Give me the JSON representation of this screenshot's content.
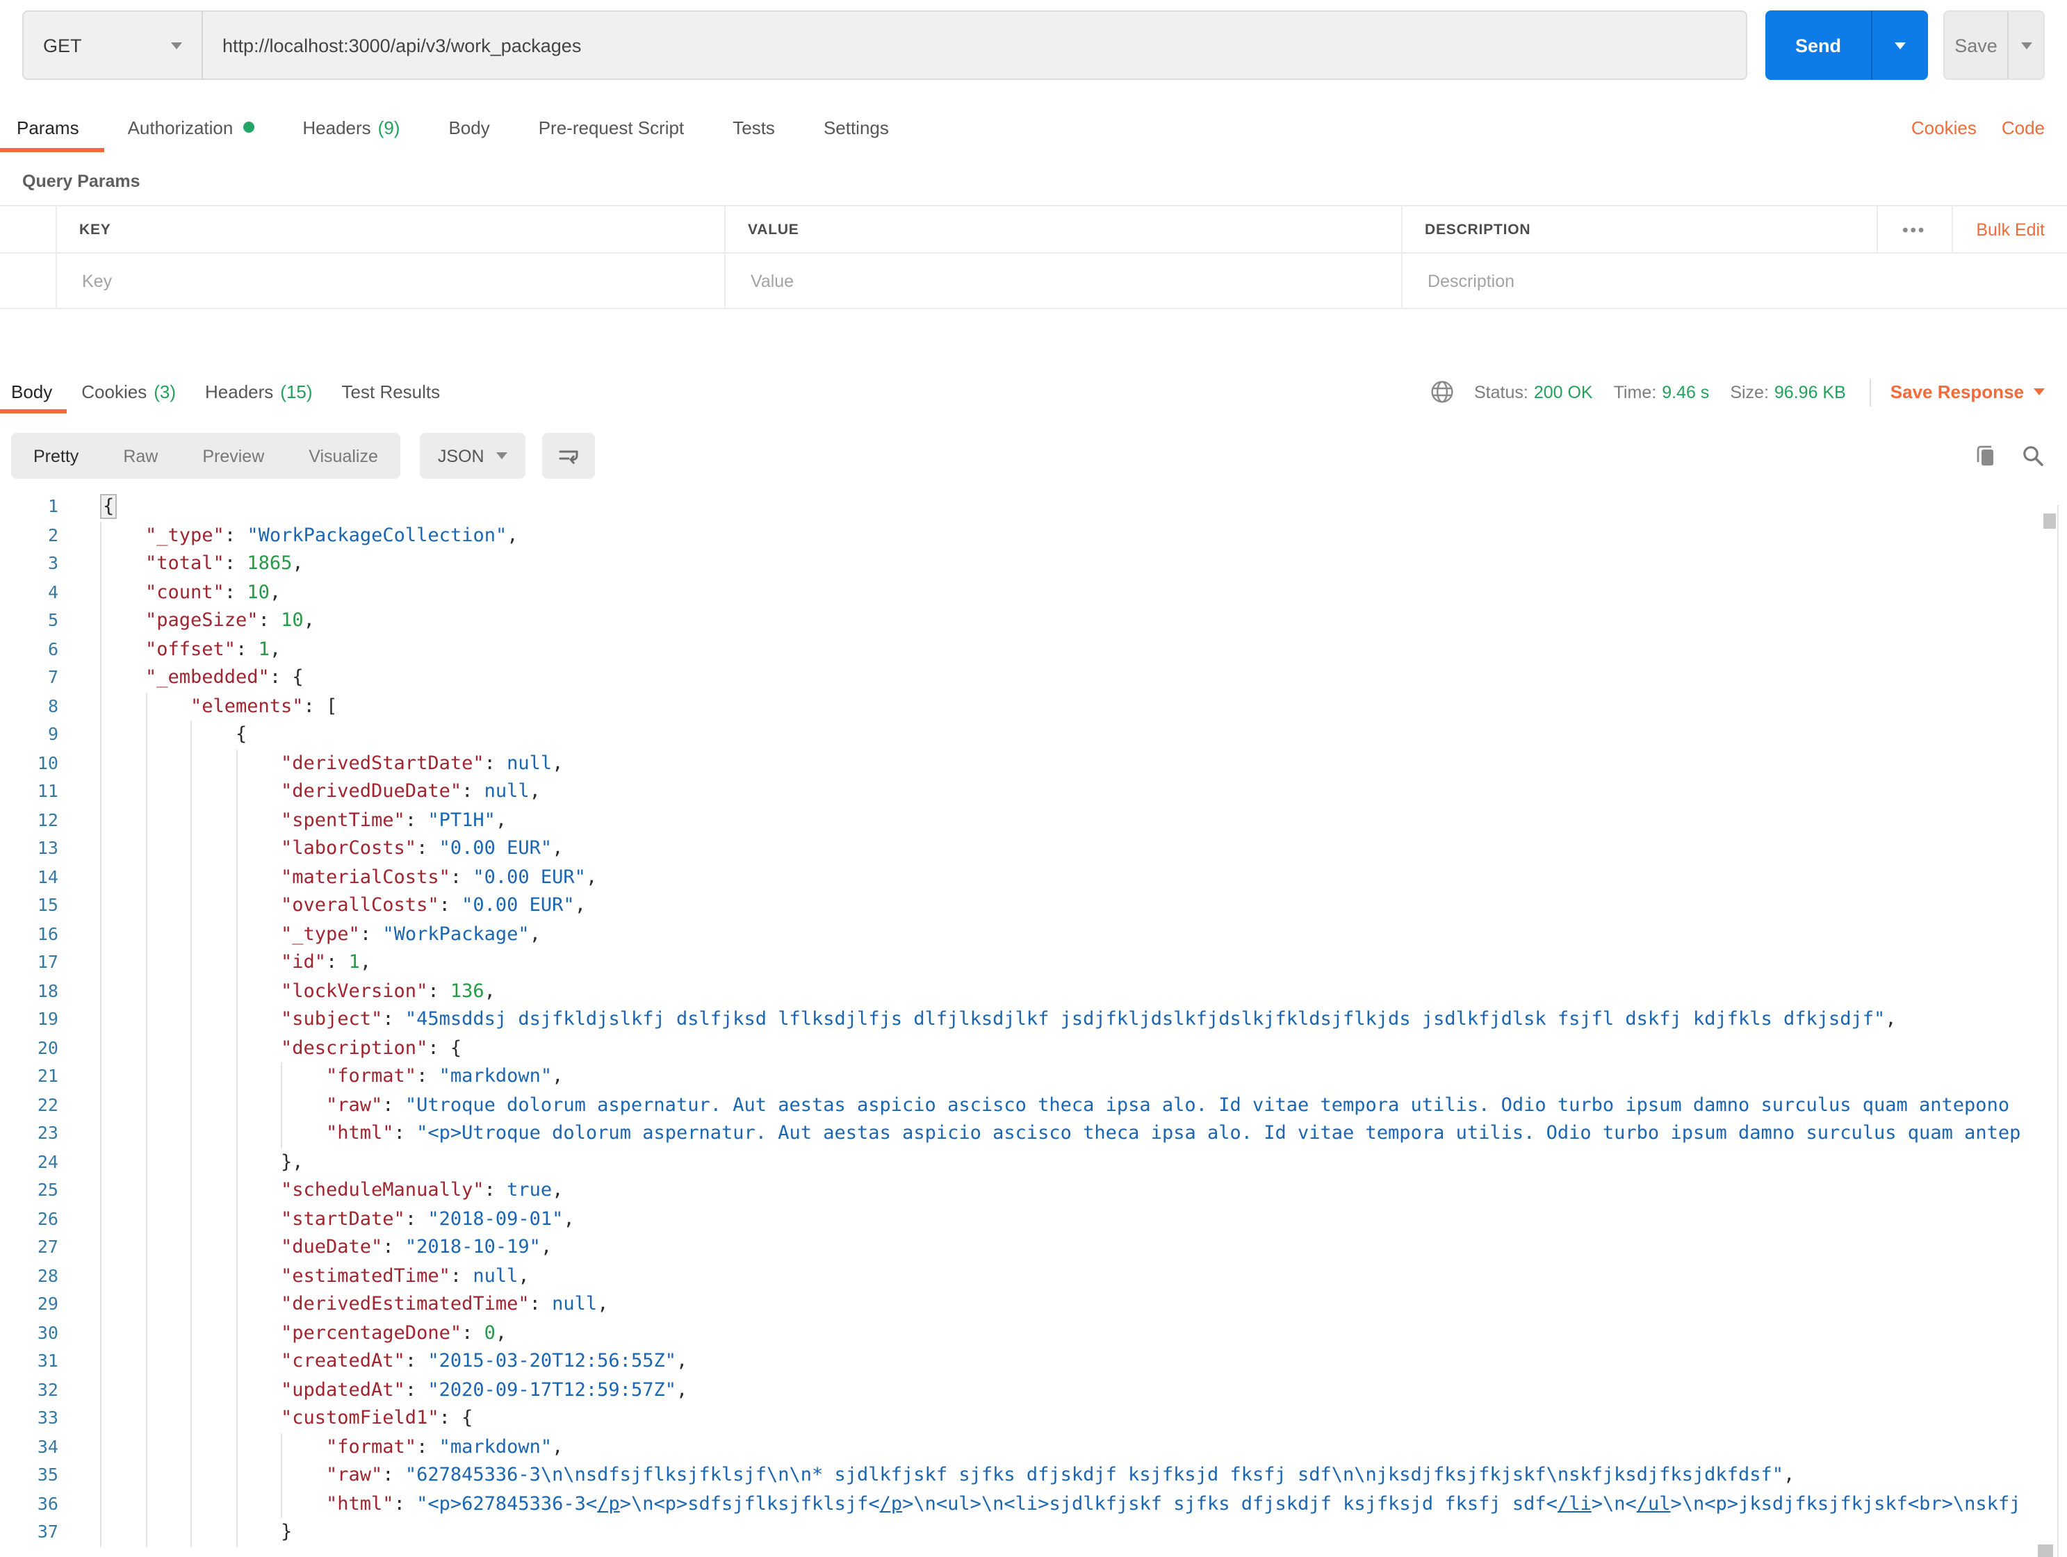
{
  "colors": {
    "orange": "#F26B3B",
    "blue": "#0D7CE8",
    "green": "#21A35C",
    "code_key": "#A2242F",
    "code_str": "#1B66B3",
    "code_num": "#259B48",
    "line_no": "#3579A4"
  },
  "request": {
    "method": "GET",
    "url": "http://localhost:3000/api/v3/work_packages",
    "send_label": "Send",
    "save_label": "Save",
    "tabs": [
      {
        "label": "Params",
        "active": true
      },
      {
        "label": "Authorization",
        "dot": true
      },
      {
        "label": "Headers",
        "count": "(9)"
      },
      {
        "label": "Body"
      },
      {
        "label": "Pre-request Script"
      },
      {
        "label": "Tests"
      },
      {
        "label": "Settings"
      }
    ],
    "links": {
      "cookies": "Cookies",
      "code": "Code"
    }
  },
  "params": {
    "section_label": "Query Params",
    "columns": [
      "KEY",
      "VALUE",
      "DESCRIPTION"
    ],
    "row_placeholders": [
      "Key",
      "Value",
      "Description"
    ],
    "more_icon": "•••",
    "bulk_edit_label": "Bulk Edit"
  },
  "response": {
    "tabs": [
      {
        "label": "Body",
        "active": true
      },
      {
        "label": "Cookies",
        "count": "(3)"
      },
      {
        "label": "Headers",
        "count": "(15)"
      },
      {
        "label": "Test Results"
      }
    ],
    "meta": {
      "status_label": "Status:",
      "status_value": "200 OK",
      "time_label": "Time:",
      "time_value": "9.46 s",
      "size_label": "Size:",
      "size_value": "96.96 KB",
      "save_response_label": "Save Response"
    },
    "view_tabs": [
      "Pretty",
      "Raw",
      "Preview",
      "Visualize"
    ],
    "active_view": "Pretty",
    "language": "JSON"
  },
  "code": {
    "lines": [
      {
        "n": 1,
        "ind": 0,
        "t": [
          [
            "hb",
            "{"
          ]
        ]
      },
      {
        "n": 2,
        "ind": 1,
        "t": [
          [
            "k",
            "\"_type\""
          ],
          [
            "p",
            ": "
          ],
          [
            "s",
            "\"WorkPackageCollection\""
          ],
          [
            "p",
            ","
          ]
        ]
      },
      {
        "n": 3,
        "ind": 1,
        "t": [
          [
            "k",
            "\"total\""
          ],
          [
            "p",
            ": "
          ],
          [
            "n",
            "1865"
          ],
          [
            "p",
            ","
          ]
        ]
      },
      {
        "n": 4,
        "ind": 1,
        "t": [
          [
            "k",
            "\"count\""
          ],
          [
            "p",
            ": "
          ],
          [
            "n",
            "10"
          ],
          [
            "p",
            ","
          ]
        ]
      },
      {
        "n": 5,
        "ind": 1,
        "t": [
          [
            "k",
            "\"pageSize\""
          ],
          [
            "p",
            ": "
          ],
          [
            "n",
            "10"
          ],
          [
            "p",
            ","
          ]
        ]
      },
      {
        "n": 6,
        "ind": 1,
        "t": [
          [
            "k",
            "\"offset\""
          ],
          [
            "p",
            ": "
          ],
          [
            "n",
            "1"
          ],
          [
            "p",
            ","
          ]
        ]
      },
      {
        "n": 7,
        "ind": 1,
        "t": [
          [
            "k",
            "\"_embedded\""
          ],
          [
            "p",
            ": {"
          ]
        ]
      },
      {
        "n": 8,
        "ind": 2,
        "t": [
          [
            "k",
            "\"elements\""
          ],
          [
            "p",
            ": ["
          ]
        ]
      },
      {
        "n": 9,
        "ind": 3,
        "t": [
          [
            "p",
            "{"
          ]
        ]
      },
      {
        "n": 10,
        "ind": 4,
        "t": [
          [
            "k",
            "\"derivedStartDate\""
          ],
          [
            "p",
            ": "
          ],
          [
            "b",
            "null"
          ],
          [
            "p",
            ","
          ]
        ]
      },
      {
        "n": 11,
        "ind": 4,
        "t": [
          [
            "k",
            "\"derivedDueDate\""
          ],
          [
            "p",
            ": "
          ],
          [
            "b",
            "null"
          ],
          [
            "p",
            ","
          ]
        ]
      },
      {
        "n": 12,
        "ind": 4,
        "t": [
          [
            "k",
            "\"spentTime\""
          ],
          [
            "p",
            ": "
          ],
          [
            "s",
            "\"PT1H\""
          ],
          [
            "p",
            ","
          ]
        ]
      },
      {
        "n": 13,
        "ind": 4,
        "t": [
          [
            "k",
            "\"laborCosts\""
          ],
          [
            "p",
            ": "
          ],
          [
            "s",
            "\"0.00 EUR\""
          ],
          [
            "p",
            ","
          ]
        ]
      },
      {
        "n": 14,
        "ind": 4,
        "t": [
          [
            "k",
            "\"materialCosts\""
          ],
          [
            "p",
            ": "
          ],
          [
            "s",
            "\"0.00 EUR\""
          ],
          [
            "p",
            ","
          ]
        ]
      },
      {
        "n": 15,
        "ind": 4,
        "t": [
          [
            "k",
            "\"overallCosts\""
          ],
          [
            "p",
            ": "
          ],
          [
            "s",
            "\"0.00 EUR\""
          ],
          [
            "p",
            ","
          ]
        ]
      },
      {
        "n": 16,
        "ind": 4,
        "t": [
          [
            "k",
            "\"_type\""
          ],
          [
            "p",
            ": "
          ],
          [
            "s",
            "\"WorkPackage\""
          ],
          [
            "p",
            ","
          ]
        ]
      },
      {
        "n": 17,
        "ind": 4,
        "t": [
          [
            "k",
            "\"id\""
          ],
          [
            "p",
            ": "
          ],
          [
            "n",
            "1"
          ],
          [
            "p",
            ","
          ]
        ]
      },
      {
        "n": 18,
        "ind": 4,
        "t": [
          [
            "k",
            "\"lockVersion\""
          ],
          [
            "p",
            ": "
          ],
          [
            "n",
            "136"
          ],
          [
            "p",
            ","
          ]
        ]
      },
      {
        "n": 19,
        "ind": 4,
        "t": [
          [
            "k",
            "\"subject\""
          ],
          [
            "p",
            ": "
          ],
          [
            "s",
            "\"45msddsj dsjfkldjslkfj dslfjksd lflksdjlfjs dlfjlksdjlkf jsdjfkljdslkfjdslkjfkldsjflkjds jsdlkfjdlsk fsjfl dskfj kdjfkls dfkjsdjf\""
          ],
          [
            "p",
            ","
          ]
        ]
      },
      {
        "n": 20,
        "ind": 4,
        "t": [
          [
            "k",
            "\"description\""
          ],
          [
            "p",
            ": {"
          ]
        ]
      },
      {
        "n": 21,
        "ind": 5,
        "t": [
          [
            "k",
            "\"format\""
          ],
          [
            "p",
            ": "
          ],
          [
            "s",
            "\"markdown\""
          ],
          [
            "p",
            ","
          ]
        ]
      },
      {
        "n": 22,
        "ind": 5,
        "t": [
          [
            "k",
            "\"raw\""
          ],
          [
            "p",
            ": "
          ],
          [
            "s",
            "\"Utroque dolorum aspernatur. Aut aestas aspicio ascisco theca ipsa alo. Id vitae tempora utilis. Odio turbo ipsum damno surculus quam antepono"
          ]
        ]
      },
      {
        "n": 23,
        "ind": 5,
        "t": [
          [
            "k",
            "\"html\""
          ],
          [
            "p",
            ": "
          ],
          [
            "s",
            "\"<p>Utroque dolorum aspernatur. Aut aestas aspicio ascisco theca ipsa alo. Id vitae tempora utilis. Odio turbo ipsum damno surculus quam antep"
          ]
        ]
      },
      {
        "n": 24,
        "ind": 4,
        "t": [
          [
            "p",
            "},"
          ]
        ]
      },
      {
        "n": 25,
        "ind": 4,
        "t": [
          [
            "k",
            "\"scheduleManually\""
          ],
          [
            "p",
            ": "
          ],
          [
            "b",
            "true"
          ],
          [
            "p",
            ","
          ]
        ]
      },
      {
        "n": 26,
        "ind": 4,
        "t": [
          [
            "k",
            "\"startDate\""
          ],
          [
            "p",
            ": "
          ],
          [
            "s",
            "\"2018-09-01\""
          ],
          [
            "p",
            ","
          ]
        ]
      },
      {
        "n": 27,
        "ind": 4,
        "t": [
          [
            "k",
            "\"dueDate\""
          ],
          [
            "p",
            ": "
          ],
          [
            "s",
            "\"2018-10-19\""
          ],
          [
            "p",
            ","
          ]
        ]
      },
      {
        "n": 28,
        "ind": 4,
        "t": [
          [
            "k",
            "\"estimatedTime\""
          ],
          [
            "p",
            ": "
          ],
          [
            "b",
            "null"
          ],
          [
            "p",
            ","
          ]
        ]
      },
      {
        "n": 29,
        "ind": 4,
        "t": [
          [
            "k",
            "\"derivedEstimatedTime\""
          ],
          [
            "p",
            ": "
          ],
          [
            "b",
            "null"
          ],
          [
            "p",
            ","
          ]
        ]
      },
      {
        "n": 30,
        "ind": 4,
        "t": [
          [
            "k",
            "\"percentageDone\""
          ],
          [
            "p",
            ": "
          ],
          [
            "n",
            "0"
          ],
          [
            "p",
            ","
          ]
        ]
      },
      {
        "n": 31,
        "ind": 4,
        "t": [
          [
            "k",
            "\"createdAt\""
          ],
          [
            "p",
            ": "
          ],
          [
            "s",
            "\"2015-03-20T12:56:55Z\""
          ],
          [
            "p",
            ","
          ]
        ]
      },
      {
        "n": 32,
        "ind": 4,
        "t": [
          [
            "k",
            "\"updatedAt\""
          ],
          [
            "p",
            ": "
          ],
          [
            "s",
            "\"2020-09-17T12:59:57Z\""
          ],
          [
            "p",
            ","
          ]
        ]
      },
      {
        "n": 33,
        "ind": 4,
        "t": [
          [
            "k",
            "\"customField1\""
          ],
          [
            "p",
            ": {"
          ]
        ]
      },
      {
        "n": 34,
        "ind": 5,
        "t": [
          [
            "k",
            "\"format\""
          ],
          [
            "p",
            ": "
          ],
          [
            "s",
            "\"markdown\""
          ],
          [
            "p",
            ","
          ]
        ]
      },
      {
        "n": 35,
        "ind": 5,
        "t": [
          [
            "k",
            "\"raw\""
          ],
          [
            "p",
            ": "
          ],
          [
            "s",
            "\"627845336-3\\n\\nsdfsjflksjfklsjf\\n\\n* sjdlkfjskf sjfks dfjskdjf ksjfksjd fksfj sdf\\n\\njksdjfksjfkjskf\\nskfjksdjfksjdkfdsf\""
          ],
          [
            "p",
            ","
          ]
        ]
      },
      {
        "n": 36,
        "ind": 5,
        "t": [
          [
            "k",
            "\"html\""
          ],
          [
            "p",
            ": "
          ],
          [
            "s",
            "\"<p>627845336-3<"
          ],
          [
            "su",
            "/p"
          ],
          [
            "s",
            ">\\n<p>sdfsjflksjfklsjf<"
          ],
          [
            "su",
            "/p"
          ],
          [
            "s",
            ">\\n<ul>\\n<li>sjdlkfjskf sjfks dfjskdjf ksjfksjd fksfj sdf<"
          ],
          [
            "su",
            "/li"
          ],
          [
            "s",
            ">\\n<"
          ],
          [
            "su",
            "/ul"
          ],
          [
            "s",
            ">\\n<p>jksdjfksjfkjskf<br>\\nskfj"
          ]
        ]
      },
      {
        "n": 37,
        "ind": 4,
        "t": [
          [
            "p",
            "}"
          ]
        ]
      }
    ]
  }
}
